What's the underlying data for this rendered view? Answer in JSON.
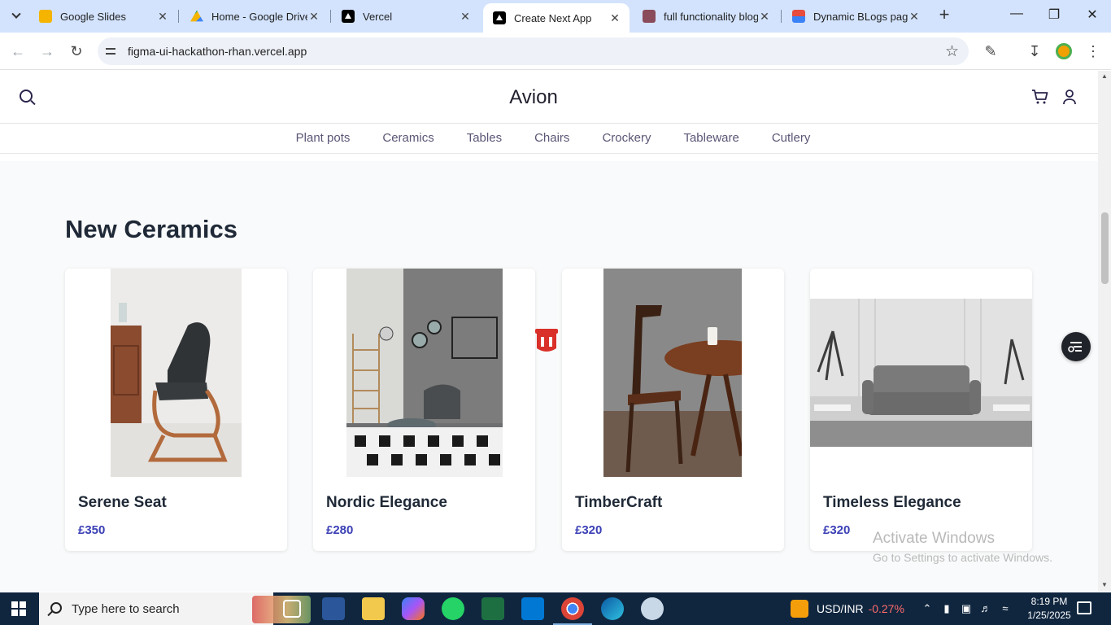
{
  "browser": {
    "tabs": [
      {
        "label": "Google Slides",
        "icon": "google-slides-icon"
      },
      {
        "label": "Home - Google Drive",
        "icon": "google-drive-icon"
      },
      {
        "label": "Vercel",
        "icon": "vercel-icon"
      },
      {
        "label": "Create Next App",
        "icon": "vercel-icon",
        "active": true
      },
      {
        "label": "full functionality blog",
        "icon": "site-favicon"
      },
      {
        "label": "Dynamic BLogs page",
        "icon": "site-favicon"
      }
    ],
    "url": "figma-ui-hackathon-rhan.vercel.app"
  },
  "site": {
    "brand": "Avion",
    "categories": [
      "Plant pots",
      "Ceramics",
      "Tables",
      "Chairs",
      "Crockery",
      "Tableware",
      "Cutlery"
    ],
    "section_title": "New Ceramics",
    "products": [
      {
        "name": "Serene Seat",
        "price": "£350"
      },
      {
        "name": "Nordic Elegance",
        "price": "£280"
      },
      {
        "name": "TimberCraft",
        "price": "£320"
      },
      {
        "name": "Timeless Elegance",
        "price": "£320"
      }
    ]
  },
  "watermark": {
    "title": "Activate Windows",
    "subtitle": "Go to Settings to activate Windows."
  },
  "taskbar": {
    "search_placeholder": "Type here to search",
    "ticker_label": "USD/INR",
    "ticker_change": "-0.27%",
    "time": "8:19 PM",
    "date": "1/25/2025"
  },
  "colors": {
    "accent_price": "#3b40b5",
    "tabstrip": "#d3e3fd",
    "taskbar": "#10263f"
  }
}
